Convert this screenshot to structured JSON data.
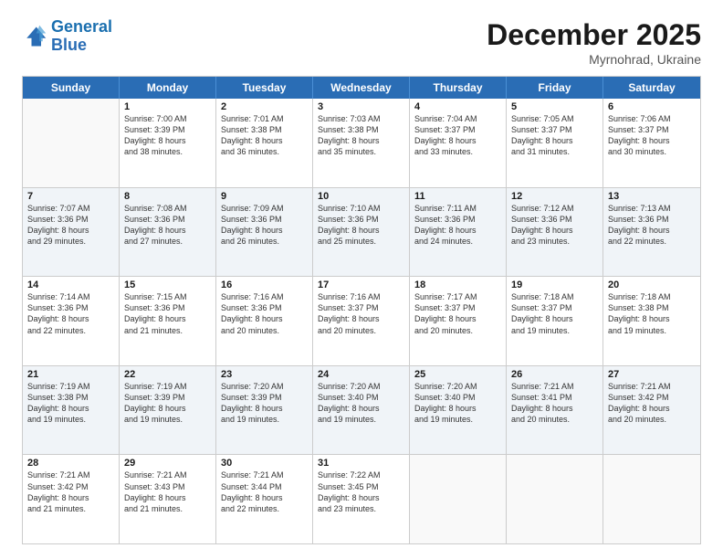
{
  "logo": {
    "line1": "General",
    "line2": "Blue"
  },
  "header": {
    "month": "December 2025",
    "location": "Myrnohrad, Ukraine"
  },
  "days": [
    "Sunday",
    "Monday",
    "Tuesday",
    "Wednesday",
    "Thursday",
    "Friday",
    "Saturday"
  ],
  "rows": [
    [
      {
        "day": "",
        "info": ""
      },
      {
        "day": "1",
        "info": "Sunrise: 7:00 AM\nSunset: 3:39 PM\nDaylight: 8 hours\nand 38 minutes."
      },
      {
        "day": "2",
        "info": "Sunrise: 7:01 AM\nSunset: 3:38 PM\nDaylight: 8 hours\nand 36 minutes."
      },
      {
        "day": "3",
        "info": "Sunrise: 7:03 AM\nSunset: 3:38 PM\nDaylight: 8 hours\nand 35 minutes."
      },
      {
        "day": "4",
        "info": "Sunrise: 7:04 AM\nSunset: 3:37 PM\nDaylight: 8 hours\nand 33 minutes."
      },
      {
        "day": "5",
        "info": "Sunrise: 7:05 AM\nSunset: 3:37 PM\nDaylight: 8 hours\nand 31 minutes."
      },
      {
        "day": "6",
        "info": "Sunrise: 7:06 AM\nSunset: 3:37 PM\nDaylight: 8 hours\nand 30 minutes."
      }
    ],
    [
      {
        "day": "7",
        "info": "Sunrise: 7:07 AM\nSunset: 3:36 PM\nDaylight: 8 hours\nand 29 minutes."
      },
      {
        "day": "8",
        "info": "Sunrise: 7:08 AM\nSunset: 3:36 PM\nDaylight: 8 hours\nand 27 minutes."
      },
      {
        "day": "9",
        "info": "Sunrise: 7:09 AM\nSunset: 3:36 PM\nDaylight: 8 hours\nand 26 minutes."
      },
      {
        "day": "10",
        "info": "Sunrise: 7:10 AM\nSunset: 3:36 PM\nDaylight: 8 hours\nand 25 minutes."
      },
      {
        "day": "11",
        "info": "Sunrise: 7:11 AM\nSunset: 3:36 PM\nDaylight: 8 hours\nand 24 minutes."
      },
      {
        "day": "12",
        "info": "Sunrise: 7:12 AM\nSunset: 3:36 PM\nDaylight: 8 hours\nand 23 minutes."
      },
      {
        "day": "13",
        "info": "Sunrise: 7:13 AM\nSunset: 3:36 PM\nDaylight: 8 hours\nand 22 minutes."
      }
    ],
    [
      {
        "day": "14",
        "info": "Sunrise: 7:14 AM\nSunset: 3:36 PM\nDaylight: 8 hours\nand 22 minutes."
      },
      {
        "day": "15",
        "info": "Sunrise: 7:15 AM\nSunset: 3:36 PM\nDaylight: 8 hours\nand 21 minutes."
      },
      {
        "day": "16",
        "info": "Sunrise: 7:16 AM\nSunset: 3:36 PM\nDaylight: 8 hours\nand 20 minutes."
      },
      {
        "day": "17",
        "info": "Sunrise: 7:16 AM\nSunset: 3:37 PM\nDaylight: 8 hours\nand 20 minutes."
      },
      {
        "day": "18",
        "info": "Sunrise: 7:17 AM\nSunset: 3:37 PM\nDaylight: 8 hours\nand 20 minutes."
      },
      {
        "day": "19",
        "info": "Sunrise: 7:18 AM\nSunset: 3:37 PM\nDaylight: 8 hours\nand 19 minutes."
      },
      {
        "day": "20",
        "info": "Sunrise: 7:18 AM\nSunset: 3:38 PM\nDaylight: 8 hours\nand 19 minutes."
      }
    ],
    [
      {
        "day": "21",
        "info": "Sunrise: 7:19 AM\nSunset: 3:38 PM\nDaylight: 8 hours\nand 19 minutes."
      },
      {
        "day": "22",
        "info": "Sunrise: 7:19 AM\nSunset: 3:39 PM\nDaylight: 8 hours\nand 19 minutes."
      },
      {
        "day": "23",
        "info": "Sunrise: 7:20 AM\nSunset: 3:39 PM\nDaylight: 8 hours\nand 19 minutes."
      },
      {
        "day": "24",
        "info": "Sunrise: 7:20 AM\nSunset: 3:40 PM\nDaylight: 8 hours\nand 19 minutes."
      },
      {
        "day": "25",
        "info": "Sunrise: 7:20 AM\nSunset: 3:40 PM\nDaylight: 8 hours\nand 19 minutes."
      },
      {
        "day": "26",
        "info": "Sunrise: 7:21 AM\nSunset: 3:41 PM\nDaylight: 8 hours\nand 20 minutes."
      },
      {
        "day": "27",
        "info": "Sunrise: 7:21 AM\nSunset: 3:42 PM\nDaylight: 8 hours\nand 20 minutes."
      }
    ],
    [
      {
        "day": "28",
        "info": "Sunrise: 7:21 AM\nSunset: 3:42 PM\nDaylight: 8 hours\nand 21 minutes."
      },
      {
        "day": "29",
        "info": "Sunrise: 7:21 AM\nSunset: 3:43 PM\nDaylight: 8 hours\nand 21 minutes."
      },
      {
        "day": "30",
        "info": "Sunrise: 7:21 AM\nSunset: 3:44 PM\nDaylight: 8 hours\nand 22 minutes."
      },
      {
        "day": "31",
        "info": "Sunrise: 7:22 AM\nSunset: 3:45 PM\nDaylight: 8 hours\nand 23 minutes."
      },
      {
        "day": "",
        "info": ""
      },
      {
        "day": "",
        "info": ""
      },
      {
        "day": "",
        "info": ""
      }
    ]
  ]
}
